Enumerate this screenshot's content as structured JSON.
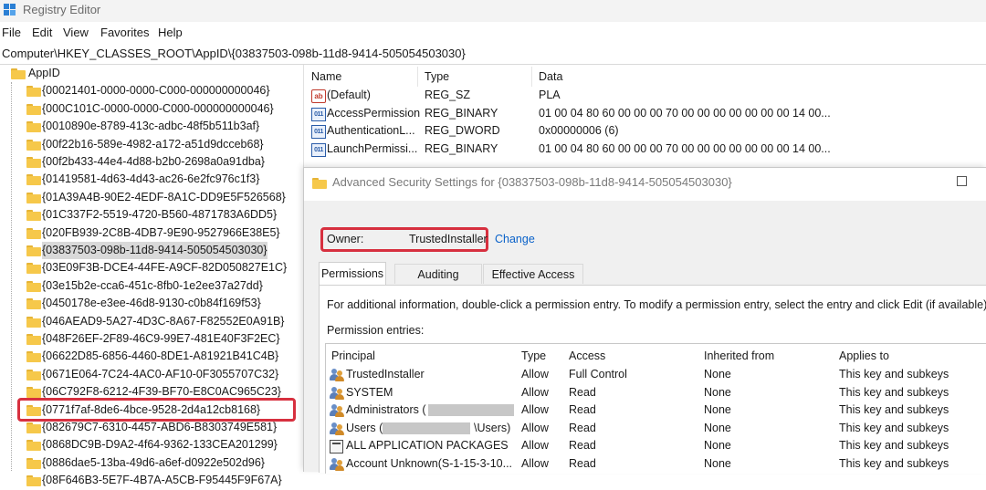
{
  "window": {
    "title": "Registry Editor"
  },
  "menu": [
    "File",
    "Edit",
    "View",
    "Favorites",
    "Help"
  ],
  "address": "Computer\\HKEY_CLASSES_ROOT\\AppID\\{03837503-098b-11d8-9414-505054503030}",
  "tree": {
    "root": "AppID",
    "items": [
      "{00021401-0000-0000-C000-000000000046}",
      "{000C101C-0000-0000-C000-000000000046}",
      "{0010890e-8789-413c-adbc-48f5b511b3af}",
      "{00f22b16-589e-4982-a172-a51d9dcceb68}",
      "{00f2b433-44e4-4d88-b2b0-2698a0a91dba}",
      "{01419581-4d63-4d43-ac26-6e2fc976c1f3}",
      "{01A39A4B-90E2-4EDF-8A1C-DD9E5F526568}",
      "{01C337F2-5519-4720-B560-4871783A6DD5}",
      "{020FB939-2C8B-4DB7-9E90-9527966E38E5}",
      "{03837503-098b-11d8-9414-505054503030}",
      "{03E09F3B-DCE4-44FE-A9CF-82D050827E1C}",
      "{03e15b2e-cca6-451c-8fb0-1e2ee37a27dd}",
      "{0450178e-e3ee-46d8-9130-c0b84f169f53}",
      "{046AEAD9-5A27-4D3C-8A67-F82552E0A91B}",
      "{048F26EF-2F89-46C9-99E7-481E40F3F2EC}",
      "{06622D85-6856-4460-8DE1-A81921B41C4B}",
      "{0671E064-7C24-4AC0-AF10-0F3055707C32}",
      "{06C792F8-6212-4F39-BF70-E8C0AC965C23}",
      "{0771f7af-8de6-4bce-9528-2d4a12cb8168}",
      "{082679C7-6310-4457-ABD6-B8303749E581}",
      "{0868DC9B-D9A2-4f64-9362-133CEA201299}",
      "{0886dae5-13ba-49d6-a6ef-d0922e502d96}",
      "{08F646B3-5E7F-4B7A-A5CB-F95445F9F67A}"
    ],
    "selected_index": 9
  },
  "values": {
    "headers": {
      "name": "Name",
      "type": "Type",
      "data": "Data"
    },
    "rows": [
      {
        "icon": "string-value-icon",
        "name": "(Default)",
        "type": "REG_SZ",
        "data": "PLA"
      },
      {
        "icon": "binary-value-icon",
        "name": "AccessPermission",
        "type": "REG_BINARY",
        "data": "01 00 04 80 60 00 00 00 70 00 00 00 00 00 00 00 14 00..."
      },
      {
        "icon": "binary-value-icon",
        "name": "AuthenticationL...",
        "type": "REG_DWORD",
        "data": "0x00000006 (6)"
      },
      {
        "icon": "binary-value-icon",
        "name": "LaunchPermissi...",
        "type": "REG_BINARY",
        "data": "01 00 04 80 60 00 00 00 70 00 00 00 00 00 00 00 14 00..."
      }
    ]
  },
  "dialog": {
    "title": "Advanced Security Settings for {03837503-098b-11d8-9414-505054503030}",
    "owner_label": "Owner:",
    "owner_value": "TrustedInstaller",
    "change_link": "Change",
    "tabs": [
      "Permissions",
      "Auditing",
      "Effective Access"
    ],
    "info": "For additional information, double-click a permission entry. To modify a permission entry, select the entry and click Edit (if available).",
    "entries_label": "Permission entries:",
    "headers": {
      "principal": "Principal",
      "type": "Type",
      "access": "Access",
      "inherited": "Inherited from",
      "applies": "Applies to"
    },
    "rows": [
      {
        "principal": "TrustedInstaller",
        "type": "Allow",
        "access": "Full Control",
        "inherited": "None",
        "applies": "This key and subkeys"
      },
      {
        "principal": "SYSTEM",
        "type": "Allow",
        "access": "Read",
        "inherited": "None",
        "applies": "This key and subkeys"
      },
      {
        "principal": "Administrators (",
        "type": "Allow",
        "access": "Read",
        "inherited": "None",
        "applies": "This key and subkeys"
      },
      {
        "principal": "Users (",
        "principal_suffix": "\\Users)",
        "type": "Allow",
        "access": "Read",
        "inherited": "None",
        "applies": "This key and subkeys"
      },
      {
        "principal": "ALL APPLICATION PACKAGES",
        "type": "Allow",
        "access": "Read",
        "inherited": "None",
        "applies": "This key and subkeys"
      },
      {
        "principal": "Account Unknown(S-1-15-3-10...",
        "type": "Allow",
        "access": "Read",
        "inherited": "None",
        "applies": "This key and subkeys"
      }
    ]
  },
  "colors": {
    "highlight_box": "#d7303f",
    "link": "#0a62c9",
    "folder": "#f6c84a"
  }
}
